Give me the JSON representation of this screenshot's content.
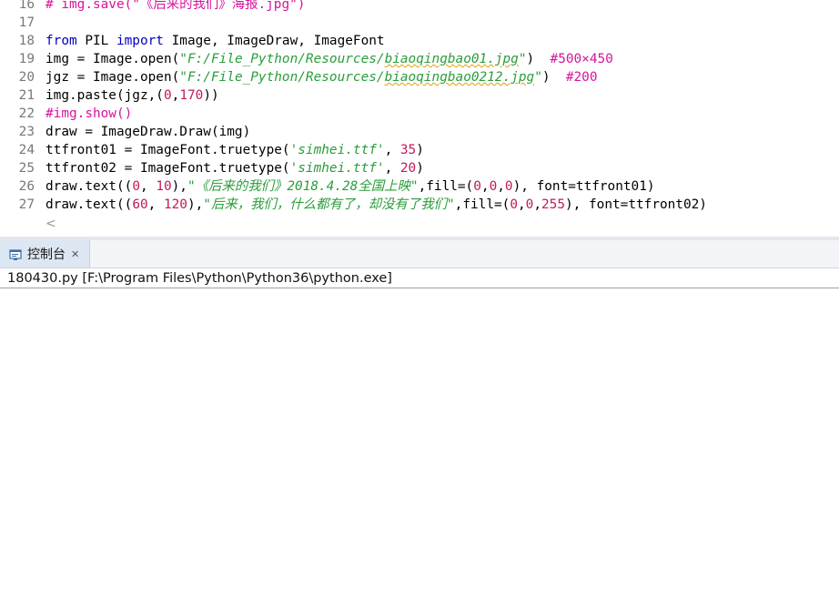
{
  "editor": {
    "lines": [
      {
        "num": "16",
        "segments": [
          {
            "t": "# img.save(\"《后来的我们》海报.jpg\")",
            "c": "cmt"
          }
        ]
      },
      {
        "num": "17",
        "segments": []
      },
      {
        "num": "18",
        "segments": [
          {
            "t": "from",
            "c": "kw"
          },
          {
            "t": " PIL ",
            "c": ""
          },
          {
            "t": "import",
            "c": "kw"
          },
          {
            "t": " Image, ImageDraw, ImageFont",
            "c": ""
          }
        ]
      },
      {
        "num": "19",
        "segments": [
          {
            "t": "img = Image.open(",
            "c": ""
          },
          {
            "t": "\"F:/File_Python/Resources/",
            "c": "str"
          },
          {
            "t": "biaoqingbao01.jpg",
            "c": "str squig"
          },
          {
            "t": "\"",
            "c": "str"
          },
          {
            "t": ")  ",
            "c": ""
          },
          {
            "t": "#500×450",
            "c": "cmt"
          }
        ]
      },
      {
        "num": "20",
        "segments": [
          {
            "t": "jgz = Image.open(",
            "c": ""
          },
          {
            "t": "\"F:/File_Python/Resources/",
            "c": "str"
          },
          {
            "t": "biaoqingbao0212.jpg",
            "c": "str squig"
          },
          {
            "t": "\"",
            "c": "str"
          },
          {
            "t": ")  ",
            "c": ""
          },
          {
            "t": "#200",
            "c": "cmt"
          }
        ]
      },
      {
        "num": "21",
        "segments": [
          {
            "t": "img.paste(jgz,(",
            "c": ""
          },
          {
            "t": "0",
            "c": "num"
          },
          {
            "t": ",",
            "c": ""
          },
          {
            "t": "170",
            "c": "num"
          },
          {
            "t": "))",
            "c": ""
          }
        ]
      },
      {
        "num": "22",
        "segments": [
          {
            "t": "#img.show()",
            "c": "cmt"
          }
        ]
      },
      {
        "num": "23",
        "segments": [
          {
            "t": "draw = ImageDraw.Draw(img)",
            "c": ""
          }
        ]
      },
      {
        "num": "24",
        "segments": [
          {
            "t": "ttfront01 = ImageFont.truetype(",
            "c": ""
          },
          {
            "t": "'simhei.ttf'",
            "c": "str"
          },
          {
            "t": ", ",
            "c": ""
          },
          {
            "t": "35",
            "c": "num"
          },
          {
            "t": ")",
            "c": ""
          }
        ]
      },
      {
        "num": "25",
        "segments": [
          {
            "t": "ttfront02 = ImageFont.truetype(",
            "c": ""
          },
          {
            "t": "'simhei.ttf'",
            "c": "str"
          },
          {
            "t": ", ",
            "c": ""
          },
          {
            "t": "20",
            "c": "num"
          },
          {
            "t": ")",
            "c": ""
          }
        ]
      },
      {
        "num": "26",
        "segments": [
          {
            "t": "draw.text((",
            "c": ""
          },
          {
            "t": "0",
            "c": "num"
          },
          {
            "t": ", ",
            "c": ""
          },
          {
            "t": "10",
            "c": "num"
          },
          {
            "t": "),",
            "c": ""
          },
          {
            "t": "\"《后来的我们》2018.4.28全国上映\"",
            "c": "str"
          },
          {
            "t": ",fill=(",
            "c": ""
          },
          {
            "t": "0",
            "c": "num"
          },
          {
            "t": ",",
            "c": ""
          },
          {
            "t": "0",
            "c": "num"
          },
          {
            "t": ",",
            "c": ""
          },
          {
            "t": "0",
            "c": "num"
          },
          {
            "t": "), font=ttfront01)",
            "c": ""
          }
        ]
      },
      {
        "num": "27",
        "segments": [
          {
            "t": "draw.text((",
            "c": ""
          },
          {
            "t": "60",
            "c": "num"
          },
          {
            "t": ", ",
            "c": ""
          },
          {
            "t": "120",
            "c": "num"
          },
          {
            "t": "),",
            "c": ""
          },
          {
            "t": "\"后来，我们，什么都有了，却没有了我们\"",
            "c": "str"
          },
          {
            "t": ",fill=(",
            "c": ""
          },
          {
            "t": "0",
            "c": "num"
          },
          {
            "t": ",",
            "c": ""
          },
          {
            "t": "0",
            "c": "num"
          },
          {
            "t": ",",
            "c": ""
          },
          {
            "t": "255",
            "c": "num"
          },
          {
            "t": "), font=ttfront02)",
            "c": ""
          }
        ]
      }
    ],
    "scroll_left_glyph": "<"
  },
  "console": {
    "tab_label": "控制台",
    "close_glyph": "✕",
    "header": "180430.py [F:\\Program Files\\Python\\Python36\\python.exe]"
  },
  "colors": {
    "keyword": "#0000c0",
    "string": "#2a9d3a",
    "number": "#c2185b",
    "comment": "#d6149c",
    "line_number": "#787878"
  },
  "icons": {
    "console_tab": "console-icon",
    "close_tab": "close-icon",
    "scroll_left": "chevron-left-icon"
  }
}
